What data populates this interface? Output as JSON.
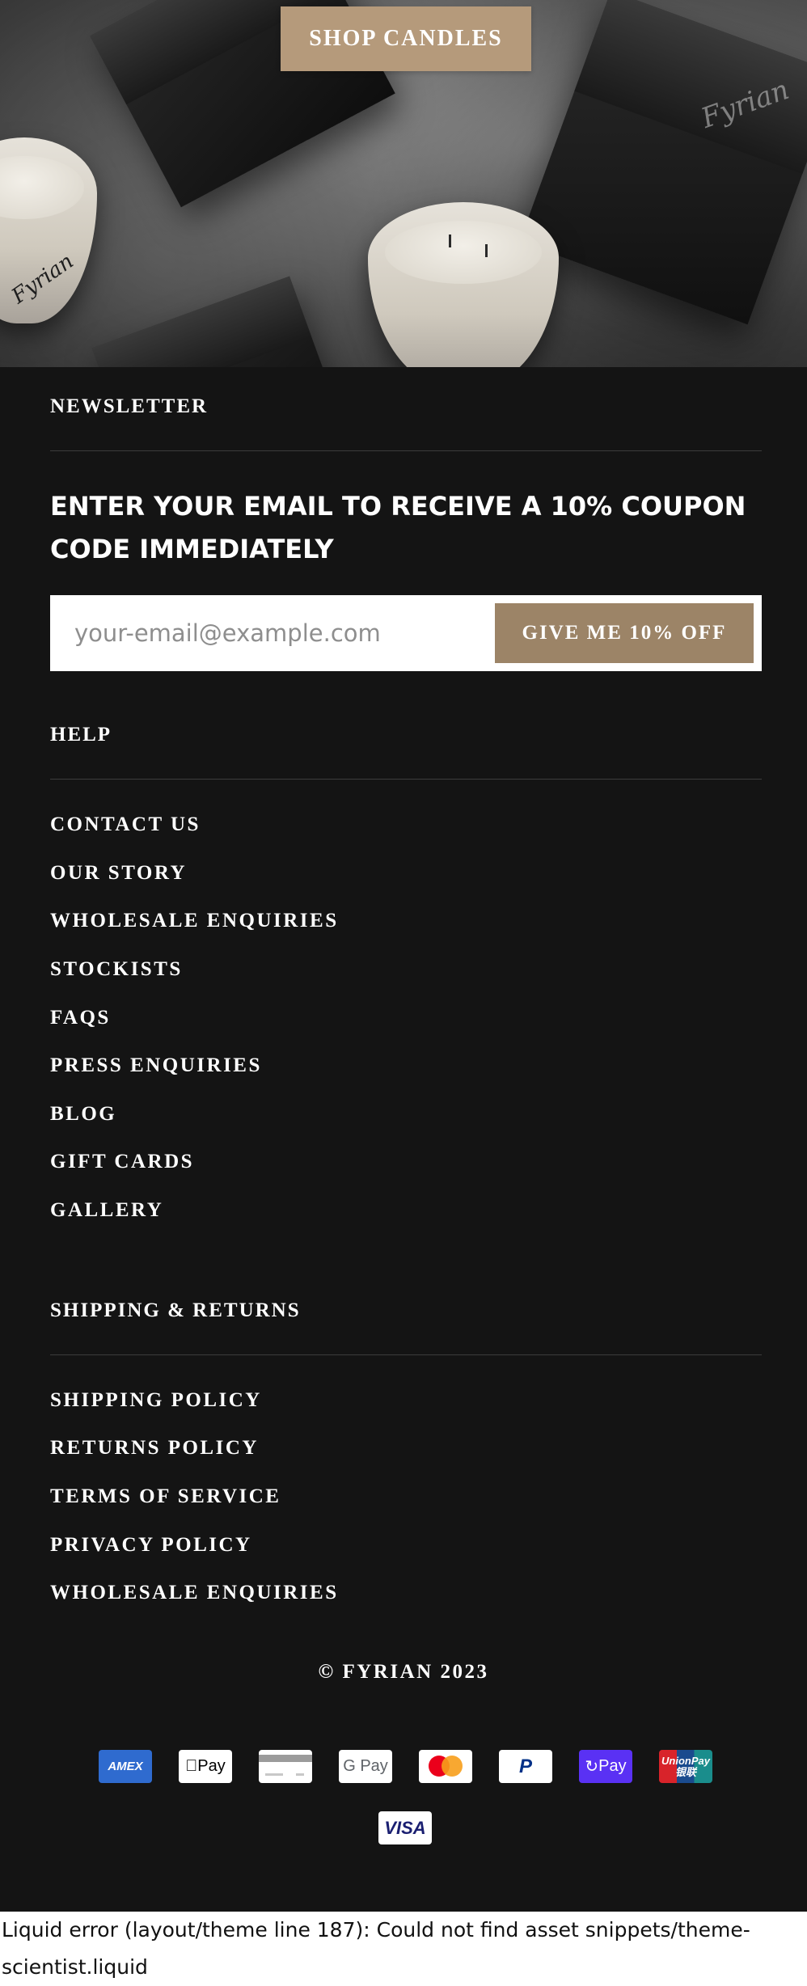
{
  "hero": {
    "shop_label": "SHOP CANDLES",
    "brand_mark": "Fyrian"
  },
  "newsletter": {
    "title": "NEWSLETTER",
    "promo": "ENTER YOUR EMAIL TO RECEIVE A 10% COUPON CODE IMMEDIATELY",
    "email_placeholder": "your-email@example.com",
    "email_value": "",
    "submit_label": "GIVE ME 10% OFF"
  },
  "help": {
    "title": "HELP",
    "links": [
      "CONTACT US",
      "OUR STORY",
      "WHOLESALE ENQUIRIES",
      "STOCKISTS",
      "FAQS",
      "PRESS ENQUIRIES",
      "BLOG",
      "GIFT CARDS",
      "GALLERY"
    ]
  },
  "shipping": {
    "title": "SHIPPING & RETURNS",
    "links": [
      "SHIPPING POLICY",
      "RETURNS POLICY",
      "TERMS OF SERVICE",
      "PRIVACY POLICY",
      "WHOLESALE ENQUIRIES"
    ]
  },
  "copyright": "© FYRIAN 2023",
  "payment_icons": [
    {
      "name": "amex-icon",
      "label": "AMEX"
    },
    {
      "name": "apple-pay-icon",
      "label": "Pay"
    },
    {
      "name": "generic-card-icon",
      "label": ""
    },
    {
      "name": "google-pay-icon",
      "label": "G Pay"
    },
    {
      "name": "mastercard-icon",
      "label": ""
    },
    {
      "name": "paypal-icon",
      "label": "P"
    },
    {
      "name": "shop-pay-icon",
      "label": "Pay"
    },
    {
      "name": "unionpay-icon",
      "label": "UnionPay 银联"
    },
    {
      "name": "visa-icon",
      "label": "VISA"
    }
  ],
  "colors": {
    "background": "#141414",
    "accent": "#9c8467",
    "hero_button": "#b59a7b"
  },
  "error_message": "Liquid error (layout/theme line 187): Could not find asset snippets/theme-scientist.liquid"
}
